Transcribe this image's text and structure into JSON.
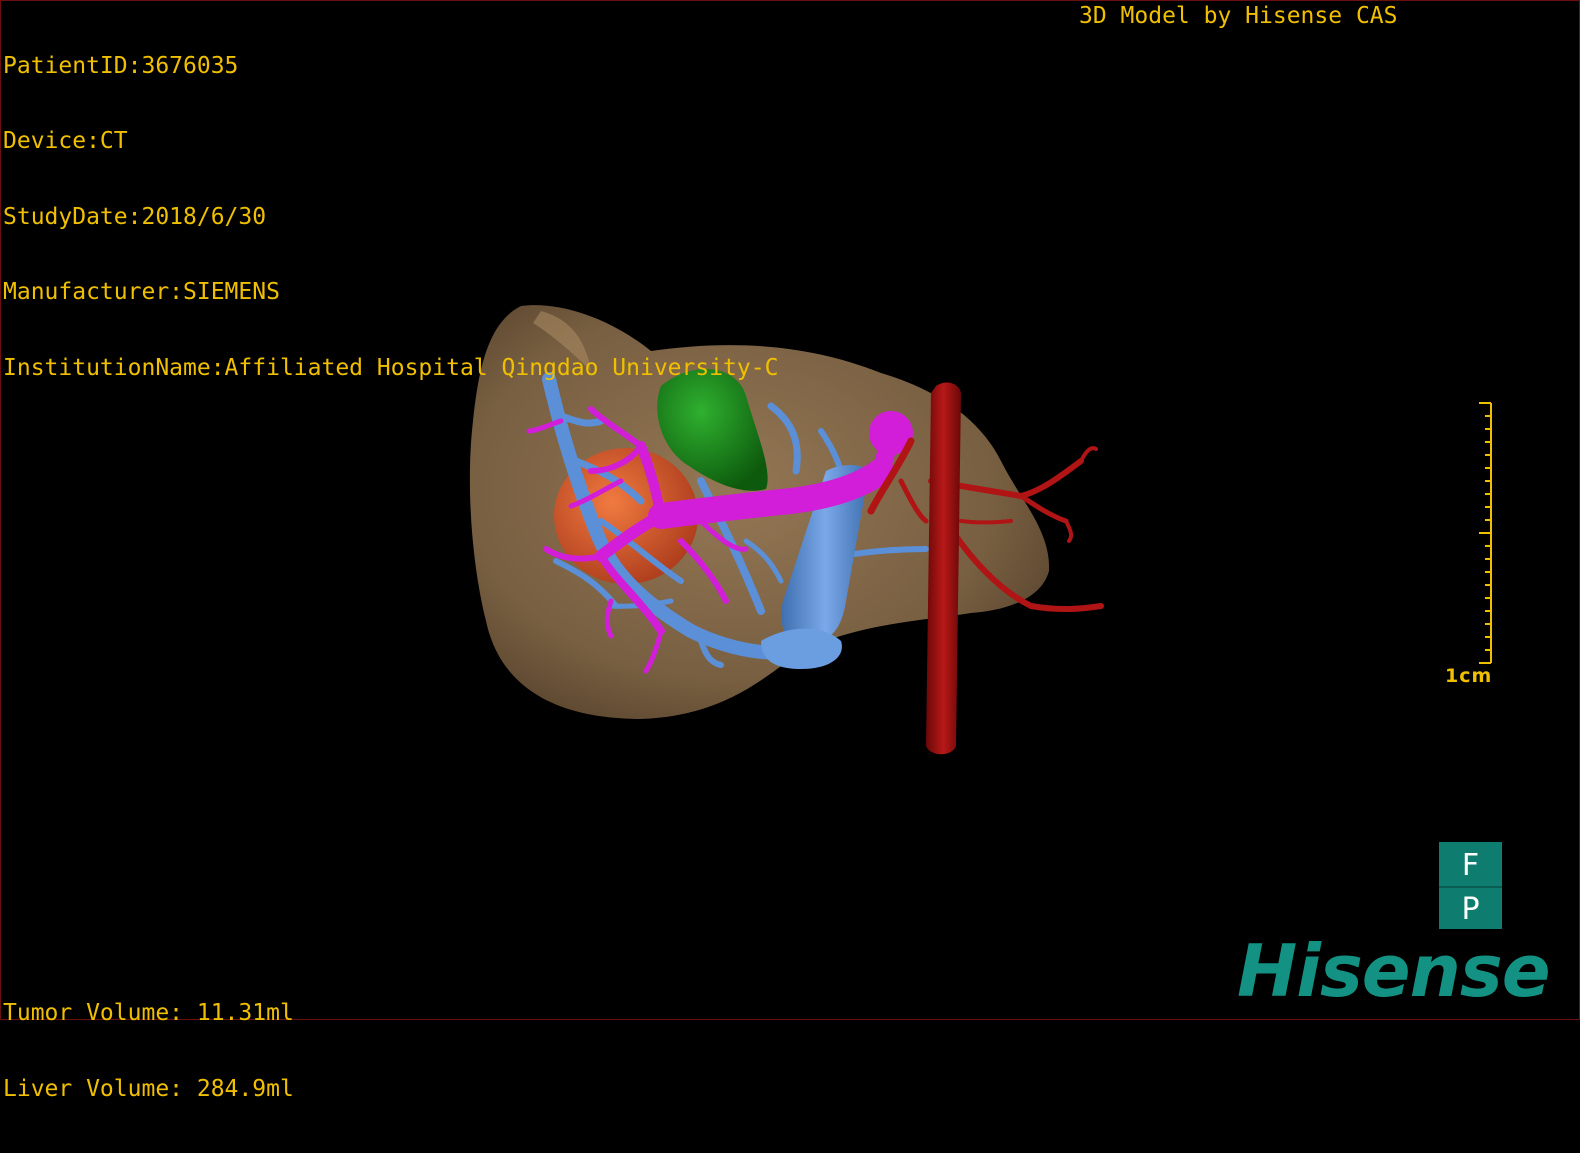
{
  "header": {
    "patient_id": "PatientID:3676035",
    "device": "Device:CT",
    "study_date": "StudyDate:2018/6/30",
    "manufacturer": "Manufacturer:SIEMENS",
    "institution": "InstitutionName:Affiliated Hospital Qingdao University-C",
    "model_credit": "3D Model by Hisense CAS"
  },
  "footer": {
    "tumor_volume": "Tumor Volume: 11.31ml",
    "liver_volume": "Liver Volume: 284.9ml"
  },
  "scale": {
    "label": "1cm"
  },
  "orientation": {
    "front": "F",
    "posterior": "P"
  },
  "brand": {
    "logo_text": "Hisense"
  },
  "colors": {
    "overlay_text": "#f0c000",
    "liver": "#8a6e4c",
    "tumor": "#d4562a",
    "gallbladder": "#1a8a1a",
    "portal_vein": "#d020d8",
    "hepatic_vein": "#5a90d8",
    "artery": "#a01010",
    "brand": "#139284"
  }
}
